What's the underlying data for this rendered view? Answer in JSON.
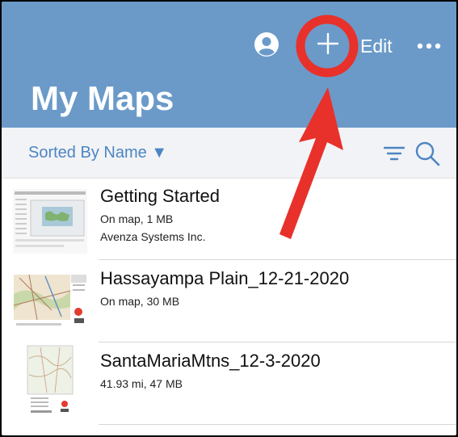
{
  "header": {
    "edit_label": "Edit",
    "title": "My Maps",
    "profile_icon": "profile-icon",
    "add_icon": "plus-icon",
    "more_icon": "more-icon"
  },
  "sortbar": {
    "sort_label": "Sorted By Name ▼",
    "filter_icon": "filter-icon",
    "search_icon": "search-icon"
  },
  "maps": [
    {
      "title": "Getting Started",
      "line1": "On map, 1 MB",
      "line2": "Avenza Systems Inc."
    },
    {
      "title": "Hassayampa Plain_12-21-2020",
      "line1": "On map, 30 MB",
      "line2": ""
    },
    {
      "title": "SantaMariaMtns_12-3-2020",
      "line1": "41.93 mi, 47 MB",
      "line2": ""
    }
  ],
  "colors": {
    "header_bg": "#6b9ac9",
    "accent": "#4c85c3",
    "annotation": "#e8312a"
  }
}
